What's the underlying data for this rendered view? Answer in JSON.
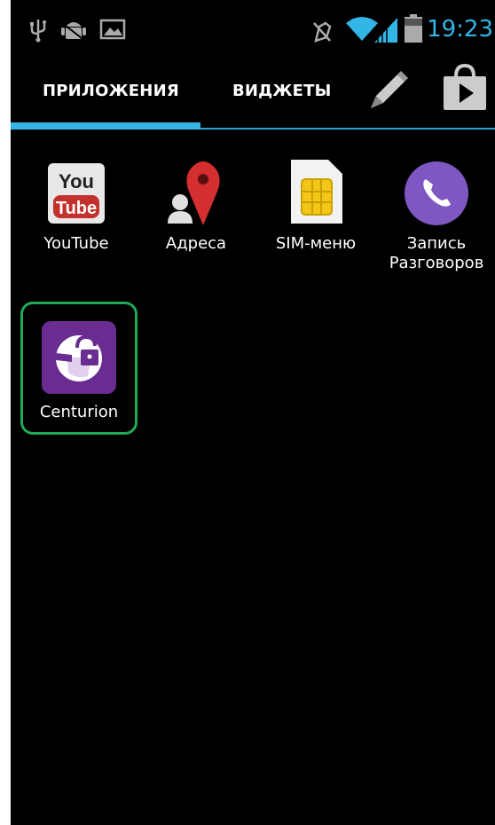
{
  "status_bar": {
    "time": "19:23",
    "left_icons": [
      "usb-icon",
      "android-debug-icon",
      "image-notification-icon"
    ],
    "right_icons": [
      "mute-icon",
      "wifi-icon",
      "signal-icon",
      "battery-icon"
    ],
    "accent_color": "#33b5e5"
  },
  "tabs": {
    "apps_label": "ПРИЛОЖЕНИЯ",
    "widgets_label": "ВИДЖЕТЫ",
    "active": "apps",
    "tools": [
      "pencil-icon",
      "play-store-icon"
    ]
  },
  "apps": [
    {
      "label": "YouTube",
      "icon": "youtube-icon",
      "icon_text_top": "You",
      "icon_text_bottom": "Tube"
    },
    {
      "label": "Адреса",
      "icon": "maps-icon"
    },
    {
      "label": "SIM-меню",
      "icon": "sim-card-icon"
    },
    {
      "label_line1": "Запись",
      "label_line2": "Разговоров",
      "icon": "call-recorder-icon"
    },
    {
      "label": "Centurion",
      "icon": "centurion-lock-icon",
      "highlighted": true,
      "highlight_color": "#1faa55"
    }
  ]
}
